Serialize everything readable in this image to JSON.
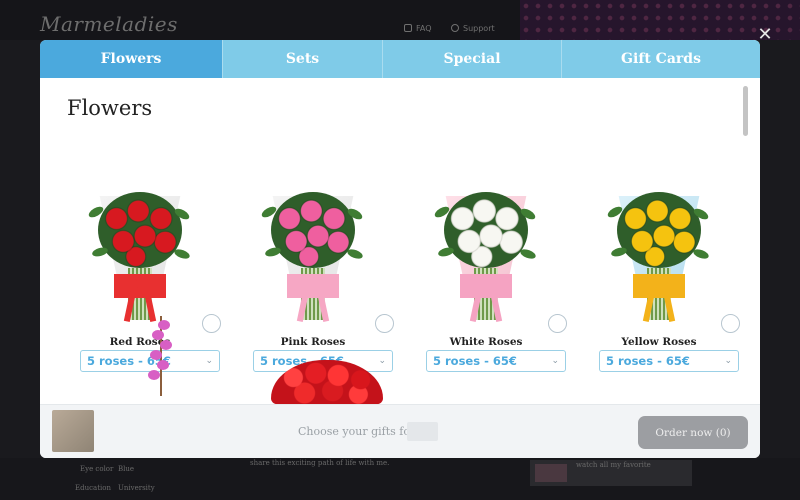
{
  "background": {
    "logo": "Marmeladies",
    "nav": {
      "faq": "FAQ",
      "support": "Support"
    },
    "profile_rows": [
      {
        "label": "Eye color",
        "value": "Blue"
      },
      {
        "label": "Education",
        "value": "University"
      }
    ],
    "body_snippet": "share this exciting path of life with me.",
    "card_snippet": "watch all my favorite"
  },
  "modal": {
    "close_icon": "close-icon",
    "tabs": [
      {
        "label": "Flowers",
        "active": true
      },
      {
        "label": "Sets",
        "active": false
      },
      {
        "label": "Special",
        "active": false
      },
      {
        "label": "Gift Cards",
        "active": false
      }
    ],
    "section_title": "Flowers",
    "products": [
      {
        "name": "Red Roses",
        "option": "5 roses - 65€",
        "flower_color": "#d71920",
        "wrap": "white",
        "bow_color": "#e83030"
      },
      {
        "name": "Pink Roses",
        "option": "5 roses - 65€",
        "flower_color": "#ef5f9f",
        "wrap": "white",
        "bow_color": "#f6a7c4"
      },
      {
        "name": "White Roses",
        "option": "5 roses - 65€",
        "flower_color": "#f7f7f2",
        "wrap": "pink",
        "bow_color": "#f5a3c2"
      },
      {
        "name": "Yellow Roses",
        "option": "5 roses - 65€",
        "flower_color": "#f5c30f",
        "wrap": "blue",
        "bow_color": "#f3b21a"
      }
    ],
    "footer": {
      "text": "Choose your gifts for",
      "order_button": "Order now (0)"
    }
  },
  "colors": {
    "tab_active": "#4ba9dd",
    "tab_inactive": "#7fcbe8",
    "accent": "#4ba9dd",
    "order_button": "#9c9ea2"
  }
}
